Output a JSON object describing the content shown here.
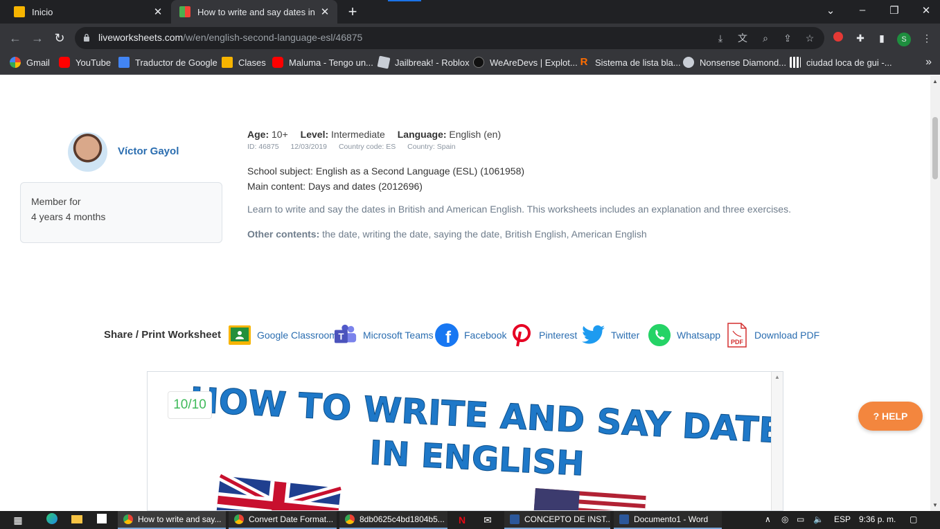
{
  "browser": {
    "tabs": [
      {
        "title": "Inicio",
        "active": false
      },
      {
        "title": "How to write and say dates in En",
        "active": true
      }
    ],
    "url_domain": "liveworksheets.com",
    "url_path": "/w/en/english-second-language-esl/46875",
    "bookmarks": [
      {
        "label": "Gmail",
        "icon": "gmail-icon"
      },
      {
        "label": "YouTube",
        "icon": "youtube-icon"
      },
      {
        "label": "Traductor de Google",
        "icon": "translate-icon"
      },
      {
        "label": "Clases",
        "icon": "classroom-icon"
      },
      {
        "label": "Maluma - Tengo un...",
        "icon": "youtube-icon"
      },
      {
        "label": "Jailbreak! - Roblox",
        "icon": "roblox-icon"
      },
      {
        "label": "WeAreDevs | Explot...",
        "icon": "wearedevs-icon"
      },
      {
        "label": "Sistema de lista bla...",
        "icon": "r-icon"
      },
      {
        "label": "Nonsense Diamond...",
        "icon": "globe-icon"
      },
      {
        "label": "ciudad loca de gui -...",
        "icon": "grid-icon"
      }
    ],
    "profile_initial": "S"
  },
  "author": {
    "name": "Víctor Gayol",
    "member_label": "Member for",
    "member_duration": "4 years 4 months"
  },
  "worksheet": {
    "age_label": "Age:",
    "age": "10+",
    "level_label": "Level:",
    "level": "Intermediate",
    "language_label": "Language:",
    "language": "English (en)",
    "id": "ID: 46875",
    "date": "12/03/2019",
    "country_code": "Country code: ES",
    "country": "Country: Spain",
    "school_subject": "School subject: English as a Second Language (ESL) (1061958)",
    "main_content": "Main content: Days and dates (2012696)",
    "description": "Learn to write and say the dates in British and American English. This worksheets includes an explanation and three exercises.",
    "other_label": "Other contents:",
    "other_contents": "the date, writing the date, saying the date, British English, American English",
    "score": "10/10"
  },
  "share": {
    "label": "Share / Print Worksheet",
    "items": [
      {
        "label": "Google Classroom",
        "icon": "google-classroom-icon"
      },
      {
        "label": "Microsoft Teams",
        "icon": "microsoft-teams-icon"
      },
      {
        "label": "Facebook",
        "icon": "facebook-icon"
      },
      {
        "label": "Pinterest",
        "icon": "pinterest-icon"
      },
      {
        "label": "Twitter",
        "icon": "twitter-icon"
      },
      {
        "label": "Whatsapp",
        "icon": "whatsapp-icon"
      },
      {
        "label": "Download PDF",
        "icon": "pdf-icon"
      }
    ]
  },
  "help_label": "HELP",
  "taskbar": {
    "apps": [
      {
        "label": "How to write and say..."
      },
      {
        "label": "Convert Date Format..."
      },
      {
        "label": "8db0625c4bd1804b5..."
      },
      {
        "label": "CONCEPTO DE INST..."
      },
      {
        "label": "Documento1 - Word"
      }
    ],
    "language": "ESP",
    "time": "9:36 p. m."
  }
}
